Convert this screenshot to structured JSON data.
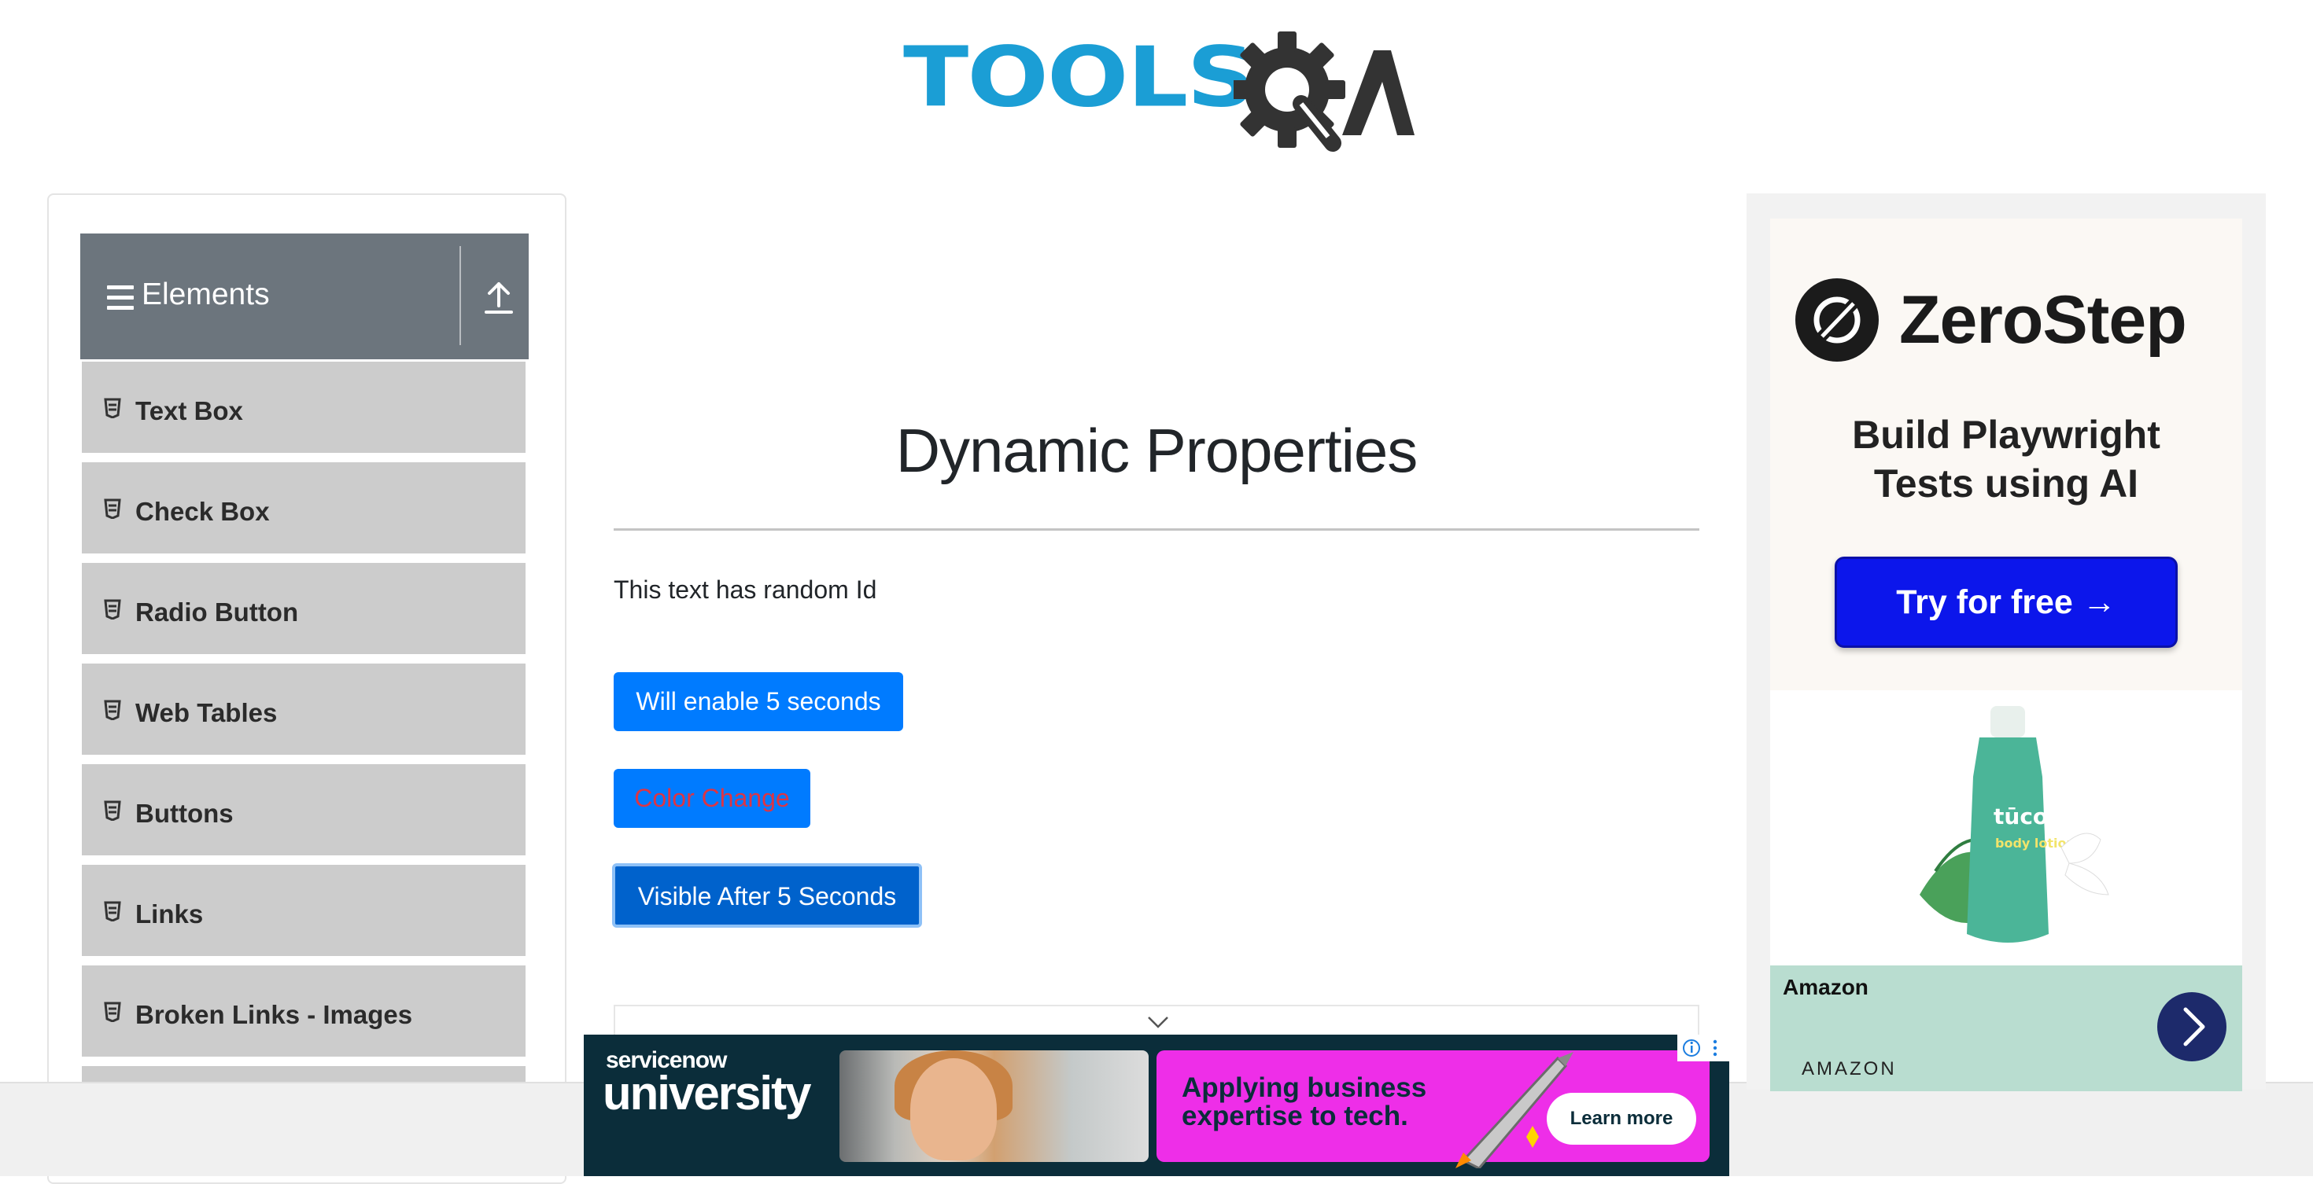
{
  "header": {
    "logo_text": "TOOLS",
    "logo_suffix": "QA"
  },
  "sidebar": {
    "group_title": "Elements",
    "items": [
      {
        "label": "Text Box"
      },
      {
        "label": "Check Box"
      },
      {
        "label": "Radio Button"
      },
      {
        "label": "Web Tables"
      },
      {
        "label": "Buttons"
      },
      {
        "label": "Links"
      },
      {
        "label": "Broken Links - Images"
      }
    ]
  },
  "main": {
    "title": "Dynamic Properties",
    "random_text": "This text has random Id",
    "buttons": {
      "enable": "Will enable 5 seconds",
      "color_change": "Color Change",
      "visible_after": "Visible After 5 Seconds"
    }
  },
  "right_ad": {
    "brand": "ZeroStep",
    "tagline": "Build Playwright Tests using AI",
    "cta": "Try for free →",
    "product_label": "tūco",
    "product_sub": "body lotion",
    "advertiser": "Amazon",
    "source": "AMAZON"
  },
  "bottom_ad": {
    "brand_small": "servicenow",
    "brand_big": "university",
    "message_line1": "Applying business",
    "message_line2": "expertise to tech.",
    "cta": "Learn more"
  },
  "colors": {
    "primary": "#007bff",
    "sidebar_header": "#6c757d",
    "sidebar_item": "#cccccc",
    "danger_text": "#dc3545",
    "logo_blue": "#1b9ed5"
  },
  "icons": [
    "hamburger-icon",
    "upload-icon",
    "list-icon",
    "chevron-down-icon",
    "zerostep-logo-icon",
    "arrow-right-icon",
    "adchoices-icon"
  ]
}
